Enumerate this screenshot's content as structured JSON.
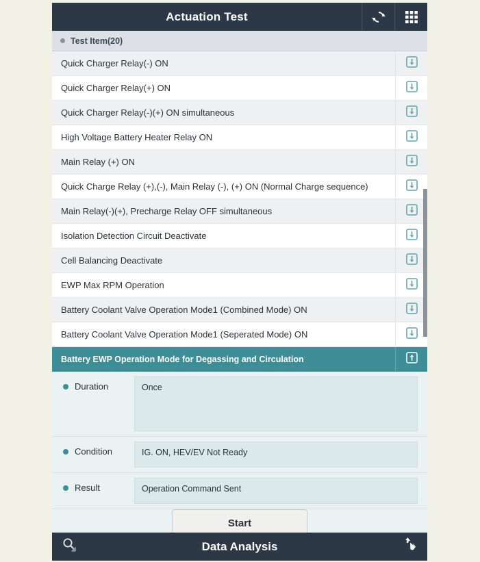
{
  "header": {
    "title": "Actuation Test",
    "refresh_icon": "refresh-icon",
    "grid_icon": "grid-menu-icon"
  },
  "section": {
    "label": "Test Item(20)"
  },
  "list": {
    "action_icon_down": "download-arrow-icon",
    "action_icon_up": "upload-arrow-icon",
    "items": [
      {
        "label": "Quick Charger Relay(-) ON",
        "selected": false
      },
      {
        "label": "Quick Charger Relay(+) ON",
        "selected": false
      },
      {
        "label": "Quick Charger Relay(-)(+) ON simultaneous",
        "selected": false
      },
      {
        "label": "High Voltage Battery Heater Relay ON",
        "selected": false
      },
      {
        "label": "Main Relay (+) ON",
        "selected": false
      },
      {
        "label": "Quick Charge Relay (+),(-), Main Relay (-), (+) ON (Normal Charge sequence)",
        "selected": false
      },
      {
        "label": "Main Relay(-)(+), Precharge Relay OFF simultaneous",
        "selected": false
      },
      {
        "label": "Isolation Detection Circuit Deactivate",
        "selected": false
      },
      {
        "label": "Cell Balancing Deactivate",
        "selected": false
      },
      {
        "label": "EWP Max RPM Operation",
        "selected": false
      },
      {
        "label": "Battery Coolant Valve Operation Mode1 (Combined Mode) ON",
        "selected": false
      },
      {
        "label": "Battery Coolant Valve Operation Mode1 (Seperated Mode) ON",
        "selected": false
      },
      {
        "label": "Battery EWP Operation Mode for Degassing and Circulation",
        "selected": true
      }
    ]
  },
  "detail": {
    "duration_label": "Duration",
    "duration_value": "Once",
    "condition_label": "Condition",
    "condition_value": "IG. ON, HEV/EV Not Ready",
    "result_label": "Result",
    "result_value": "Operation Command Sent",
    "start_label": "Start"
  },
  "footer": {
    "title": "Data Analysis",
    "search_icon": "magnifier-icon",
    "pointer_icon": "hand-pointer-icon"
  },
  "colors": {
    "accent_teal": "#3d8e96",
    "bar_dark": "#2c3845",
    "page_bg": "#f2f1e5",
    "row_alt": "#eef0f2",
    "detail_bg": "#eaf2f3",
    "field_bg": "#dbe9ea"
  }
}
